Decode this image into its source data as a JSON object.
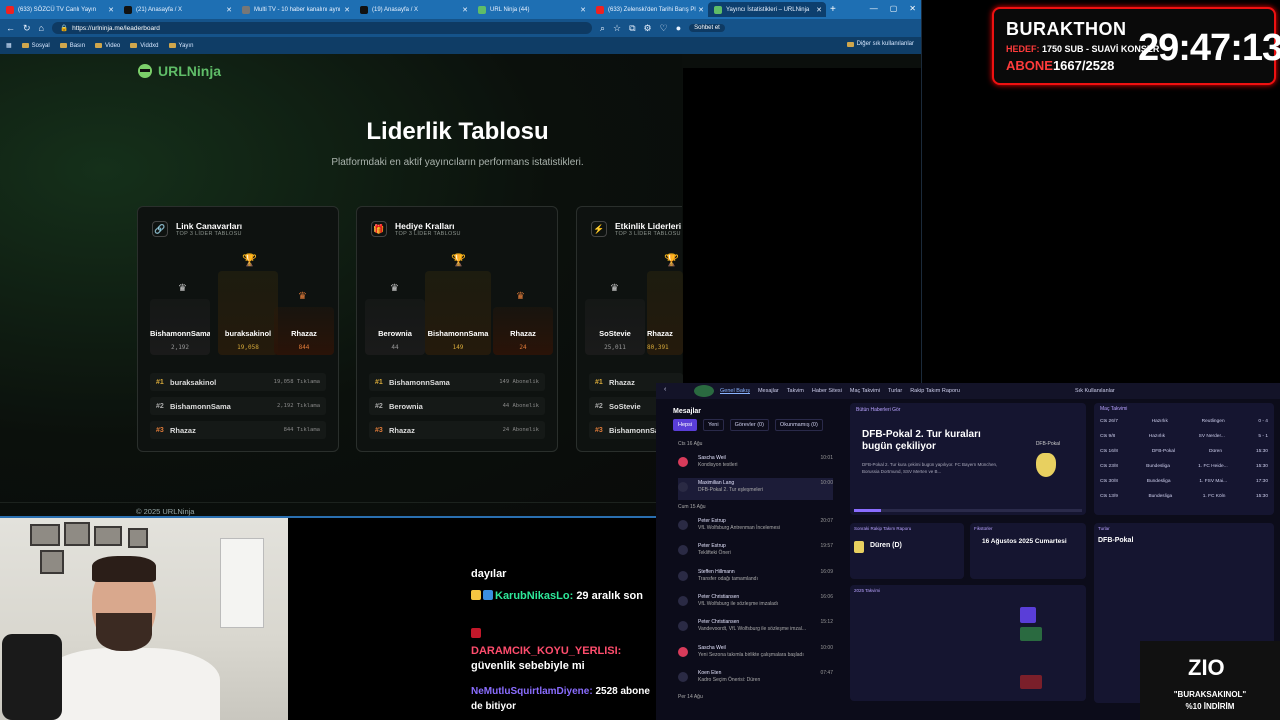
{
  "browser": {
    "tabs": [
      {
        "label": "(633) SÖZCÜ TV Canlı Yayın",
        "color": "#e22"
      },
      {
        "label": "(21) Anasayfa / X",
        "color": "#111"
      },
      {
        "label": "Multi TV - 10 haber kanalını aynı",
        "color": "#777"
      },
      {
        "label": "(19) Anasayfa / X",
        "color": "#111"
      },
      {
        "label": "URL Ninja (44)",
        "color": "#5fbd68"
      },
      {
        "label": "(633) Zelenski'den Tarihi Barış Pl",
        "color": "#e22"
      },
      {
        "label": "Yayıncı İstatistikleri – URLNinja",
        "color": "#5fbd68"
      }
    ],
    "url": "https://urlninja.me/leaderboard",
    "bookmarks": [
      "Sosyal",
      "Basın",
      "Video",
      "Viddxd",
      "Yayın"
    ],
    "bookmarks_right": "Diğer sık kullanılanlar",
    "sohbet": "Sohbet et"
  },
  "page": {
    "logo": "URLNinja",
    "title": "Liderlik Tablosu",
    "subtitle": "Platformdaki en aktif yayıncıların performans istatistikleri.",
    "footer": "© 2025 URLNinja"
  },
  "cards": [
    {
      "title": "Link Canavarları",
      "sub": "TOP 3 LİDER TABLOSU",
      "icon": "🔗",
      "podium": [
        {
          "name": "BishamonnSama",
          "value": "2,192"
        },
        {
          "name": "buraksakinol",
          "value": "19,058"
        },
        {
          "name": "Rhazaz",
          "value": "844"
        }
      ],
      "rows": [
        {
          "rank": "#1",
          "name": "buraksakinol",
          "value": "19,058 Tıklama"
        },
        {
          "rank": "#2",
          "name": "BishamonnSama",
          "value": "2,192 Tıklama"
        },
        {
          "rank": "#3",
          "name": "Rhazaz",
          "value": "844 Tıklama"
        }
      ]
    },
    {
      "title": "Hediye Kralları",
      "sub": "TOP 3 LİDER TABLOSU",
      "icon": "🎁",
      "podium": [
        {
          "name": "Berownia",
          "value": "44"
        },
        {
          "name": "BishamonnSama",
          "value": "149"
        },
        {
          "name": "Rhazaz",
          "value": "24"
        }
      ],
      "rows": [
        {
          "rank": "#1",
          "name": "BishamonnSama",
          "value": "149 Abonelik"
        },
        {
          "rank": "#2",
          "name": "Berownia",
          "value": "44 Abonelik"
        },
        {
          "rank": "#3",
          "name": "Rhazaz",
          "value": "24 Abonelik"
        }
      ]
    },
    {
      "title": "Etkinlik Liderleri",
      "sub": "TOP 3 LİDER TABLOSU",
      "icon": "⚡",
      "podium": [
        {
          "name": "SoStevie",
          "value": "25,011"
        },
        {
          "name": "Rhazaz",
          "value": "80,391"
        }
      ],
      "rows": [
        {
          "rank": "#1",
          "name": "Rhazaz",
          "value": ""
        },
        {
          "rank": "#2",
          "name": "SoStevie",
          "value": ""
        },
        {
          "rank": "#3",
          "name": "BishamonnSam",
          "value": ""
        }
      ]
    }
  ],
  "dashboard": {
    "nav": [
      "Genel Bakış",
      "Mesajlar",
      "Takvim",
      "Haber Sitesi",
      "Maç Takvimi",
      "Turlar",
      "Rakip Takım Raporu"
    ],
    "nav_right": "Sık Kullanılanlar",
    "messages_title": "Mesajlar",
    "msg_tabs": [
      "Hepsi",
      "Yeni",
      "Görevler (0)",
      "Okunmamış (0)"
    ],
    "day1": "Cts 16 Ağu",
    "day2": "Cum 15 Ağu",
    "day3": "Per 14 Ağu",
    "messages": [
      {
        "from": "Sascha Weil",
        "text": "Kondisyon testleri",
        "time": "10:01",
        "red": true
      },
      {
        "from": "Maximilian Lang",
        "text": "DFB-Pokal 2. Tur eşleşmeleri",
        "time": "10:00",
        "red": false
      },
      {
        "from": "Peter Estrup",
        "text": "VfL Wolfsburg Antrenman İncelemesi",
        "time": "20:07",
        "red": false
      },
      {
        "from": "Peter Estrup",
        "text": "Teklifteki Öneri",
        "time": "19:57",
        "red": false
      },
      {
        "from": "Steffen Hillmann",
        "text": "Transfer odağı tamamlandı",
        "time": "16:09",
        "red": false
      },
      {
        "from": "Peter Christiansen",
        "text": "VfL Wolfsburg ile sözleşme imzaladı",
        "time": "16:06",
        "red": false
      },
      {
        "from": "Peter Christiansen",
        "text": "Vandevoordt, VfL Wolfsburg ile sözleşme imzal...",
        "time": "15:12",
        "red": false
      },
      {
        "from": "Sascha Weil",
        "text": "Yeni Sezona takımla birlikte çalışmalara başladı",
        "time": "10:00",
        "red": true
      },
      {
        "from": "Koen Eten",
        "text": "Kadro Seçim Önerisi: Düren",
        "time": "07:47",
        "red": false
      }
    ],
    "news_tag": "Bütün Haberleri Gör",
    "news_title": "DFB-Pokal 2. Tur kuraları bugün çekiliyor",
    "news_body": "DFB-Pokal 2. Tur kura çekimi bugün yapılıyor. FC Bayern München, Borussia Dortmund, SSV Merten ve B...",
    "news_cup": "DFB-Pokal",
    "match_table_title": "Maç Takvimi",
    "match_rows": [
      {
        "d": "Cts 26/7",
        "c": "Hazırlık",
        "o": "Reutlingen",
        "r": "0 - 4"
      },
      {
        "d": "Cts 9/8",
        "c": "Hazırlık",
        "o": "SV Nerder...",
        "r": "5 - 1"
      },
      {
        "d": "Cts 16/8",
        "c": "DFB-Pokal",
        "o": "Düren",
        "r": "15:30"
      },
      {
        "d": "Cts 23/8",
        "c": "Bundesliga",
        "o": "1. FC Heide...",
        "r": "15:30"
      },
      {
        "d": "Cts 30/8",
        "c": "Bundesliga",
        "o": "1. FSV Mai...",
        "r": "17:30"
      },
      {
        "d": "Cts 13/9",
        "c": "Bundesliga",
        "o": "1. FC Köln",
        "r": "15:30"
      }
    ],
    "opp_title": "Sonraki Rakip Takım Raporu",
    "opp_name": "Düren (D)",
    "fixtures_title": "Fikstürler",
    "fixtures_date": "16 Ağustos 2025 Cumartesi",
    "cal_title": "2025 Takvimi",
    "turlar_title": "Turlar",
    "turlar_sub": "DFB-Pokal"
  },
  "chat": [
    {
      "user": "",
      "msg": "dayılar"
    },
    {
      "user": "KarubNikasLo:",
      "msg": "29 aralık son"
    },
    {
      "user": "DARAMCIK_KOYU_YERLISI:",
      "msg": "güvenlik sebebiyle mi"
    },
    {
      "user": "NeMutluSquirtlamDiyene:",
      "msg": "2528 abone de bitiyor"
    }
  ],
  "overlay": {
    "name": "BURAKTHON",
    "hedef_label": "HEDEF:",
    "hedef": "1750 SUB - SUAVİ KONSER",
    "abone_label": "ABONE",
    "abone": "1667/2528",
    "timer": "29:47:13"
  },
  "promo": {
    "brand": "ZIO",
    "line1": "\"BURAKSAKINOL\"",
    "line2": "%10 İNDİRİM"
  }
}
